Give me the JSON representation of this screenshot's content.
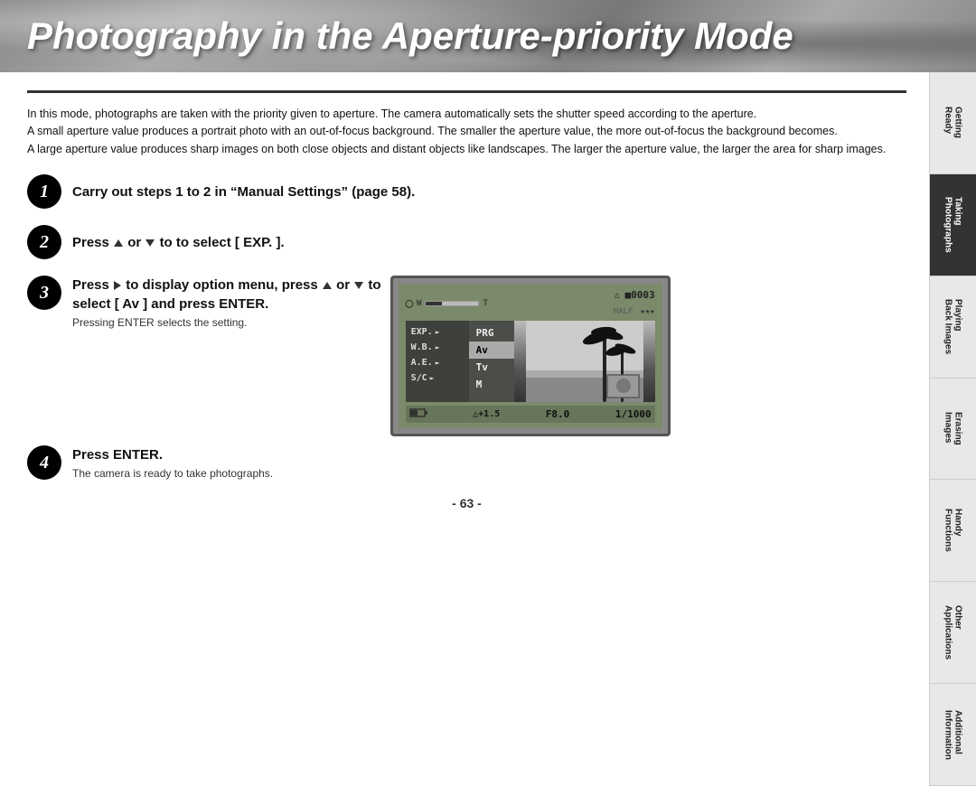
{
  "title": "Photography in the Aperture-priority Mode",
  "intro": {
    "line1": "In this mode, photographs are taken with the priority given to aperture. The camera automatically sets the shutter speed according to the aperture.",
    "line2": "A small aperture value produces a portrait photo with an out-of-focus background. The smaller the aperture value, the more out-of-focus the background becomes.",
    "line3": "A large aperture value produces sharp images on both close objects and distant objects like landscapes. The larger the aperture value, the larger the area for sharp images."
  },
  "steps": [
    {
      "number": "1",
      "main": "Carry out steps 1 to 2 in “Manual Settings” (page 58).",
      "sub": ""
    },
    {
      "number": "2",
      "main_prefix": "Press",
      "main_or": "or",
      "main_to": "to",
      "main_suffix": "to select [ EXP. ].",
      "sub": ""
    },
    {
      "number": "3",
      "main": "Press ► to display option menu, press ▲ or ▼ to select  [ Av ] and press ENTER.",
      "sub": "Pressing ENTER selects the setting."
    },
    {
      "number": "4",
      "main": "Press ENTER.",
      "sub": "The camera is ready to take photographs."
    }
  ],
  "lcd": {
    "shot_count": "■0003",
    "zoom_label_w": "W",
    "zoom_label_t": "T",
    "menu_items": [
      "EXP.►",
      "W.B.►",
      "A.E.►",
      "S/C►"
    ],
    "menu_options": [
      "PRG",
      "Av",
      "Tv",
      "M"
    ],
    "ev": "±+1.5",
    "aperture": "F8.0",
    "shutter": "1/1000",
    "flash": "★",
    "stars": "★★★"
  },
  "sidebar": {
    "tabs": [
      {
        "label": "Getting Ready",
        "active": false
      },
      {
        "label": "Taking Photographs",
        "active": true
      },
      {
        "label": "Playing Back Images",
        "active": false
      },
      {
        "label": "Erasing Images",
        "active": false
      },
      {
        "label": "Handy Functions",
        "active": false
      },
      {
        "label": "Other Applications",
        "active": false
      },
      {
        "label": "Additional Information",
        "active": false
      }
    ]
  },
  "page_number": "- 63 -"
}
